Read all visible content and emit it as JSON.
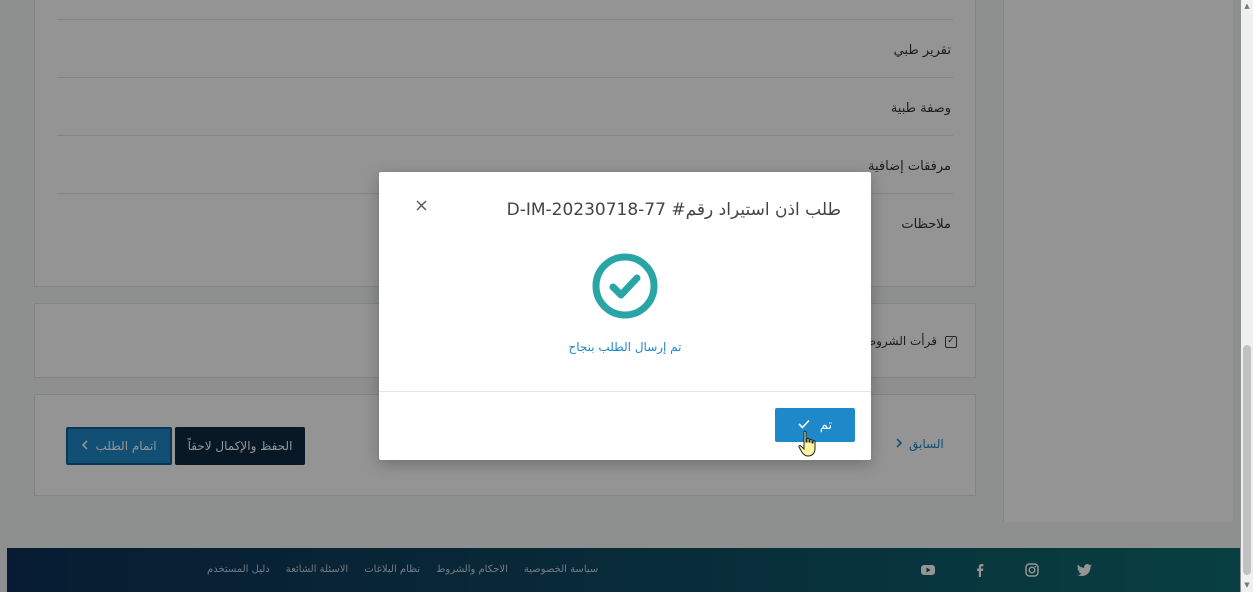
{
  "form": {
    "rows": [
      {
        "label": "تقرير طبي"
      },
      {
        "label": "وصفة طبية"
      },
      {
        "label": "مرفقات إضافية"
      },
      {
        "label": "ملاحظات"
      }
    ]
  },
  "terms": {
    "label": "قرأت الشروط",
    "checked": true
  },
  "actions": {
    "complete_label": "اتمام الطلب",
    "save_later_label": "الحفظ والإكمال لاحقاً",
    "previous_label": "السابق"
  },
  "footer": {
    "links": [
      "سياسة الخصوصية",
      "الاحكام والشروط",
      "نظام البلاغات",
      "الاسئلة الشائعة",
      "دليل المستخدم"
    ],
    "social_icons": [
      "youtube-icon",
      "facebook-icon",
      "instagram-icon",
      "twitter-icon"
    ]
  },
  "modal": {
    "title": "طلب اذن استيراد رقم# D-IM-20230718-77",
    "message": "تم إرسال الطلب بنجاح",
    "confirm_label": "تم",
    "success_color": "#2aa5a6",
    "accent_color": "#1e89c9"
  }
}
